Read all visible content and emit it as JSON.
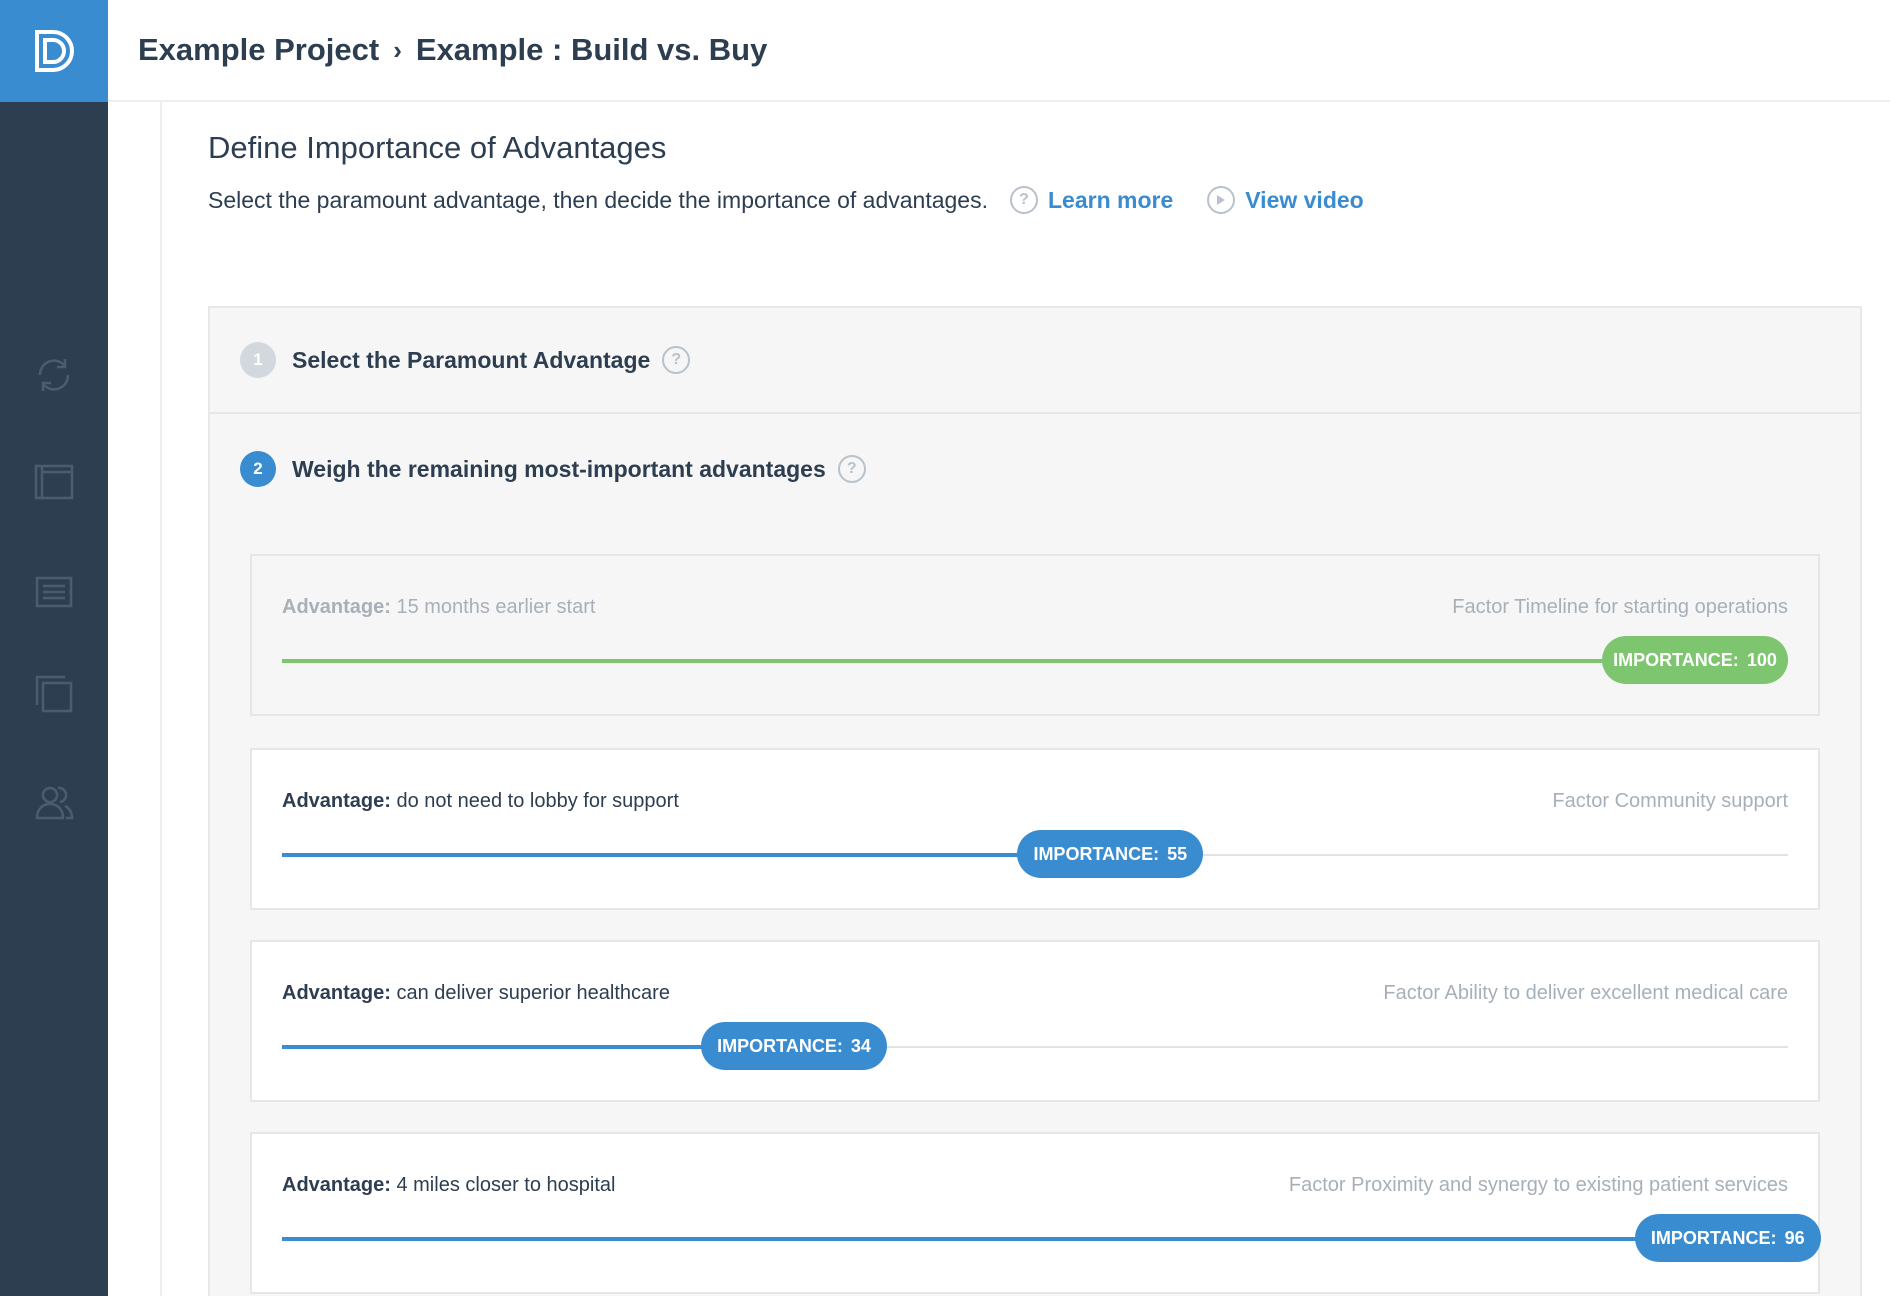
{
  "header": {
    "project": "Example Project",
    "separator": "›",
    "page": "Example : Build vs. Buy"
  },
  "sidebar": {
    "logo_icon": "d-logo-icon",
    "items": [
      {
        "icon": "sync-icon"
      },
      {
        "icon": "folder-icon"
      },
      {
        "icon": "list-icon"
      },
      {
        "icon": "copy-icon"
      },
      {
        "icon": "users-icon"
      }
    ]
  },
  "main": {
    "title": "Define Importance of Advantages",
    "subtitle": "Select the paramount advantage, then decide the importance of advantages.",
    "learn_more": "Learn more",
    "view_video": "View video",
    "help_glyph": "?"
  },
  "steps": [
    {
      "number": "1",
      "title": "Select the Paramount Advantage"
    },
    {
      "number": "2",
      "title": "Weigh the remaining most-important advantages"
    }
  ],
  "advantages": [
    {
      "prefix": "Advantage:",
      "text": "15 months earlier start",
      "factor": "Factor Timeline for starting operations",
      "importance_label": "IMPORTANCE:",
      "importance": 100,
      "importance_text": "100",
      "paramount": true
    },
    {
      "prefix": "Advantage:",
      "text": "do not need to lobby for support",
      "factor": "Factor Community support",
      "importance_label": "IMPORTANCE:",
      "importance": 55,
      "importance_text": "55",
      "paramount": false
    },
    {
      "prefix": "Advantage:",
      "text": "can deliver superior healthcare",
      "factor": "Factor Ability to deliver excellent medical care",
      "importance_label": "IMPORTANCE:",
      "importance": 34,
      "importance_text": "34",
      "paramount": false
    },
    {
      "prefix": "Advantage:",
      "text": "4 miles closer to hospital",
      "factor": "Factor Proximity and synergy to existing patient services",
      "importance_label": "IMPORTANCE:",
      "importance": 96,
      "importance_text": "96",
      "paramount": false
    }
  ],
  "colors": {
    "sidebar": "#2d3e50",
    "accent": "#3a8cd0",
    "paramount": "#7dc66f"
  }
}
